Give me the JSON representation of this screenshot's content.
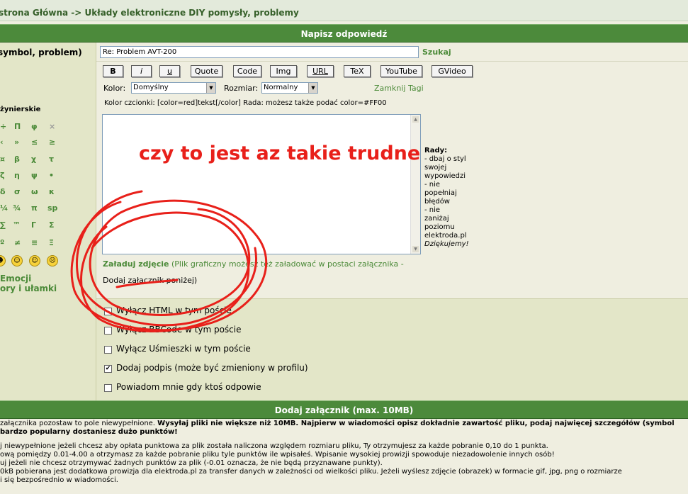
{
  "breadcrumb": "strona Główna -> Układy elektroniczne DIY pomysły, problemy",
  "reply_bar": "Napisz odpowiedź",
  "subject": {
    "label": "symbol, problem)",
    "value": "Re: Problem AVT-200",
    "search": "Szukaj"
  },
  "toolbar": [
    "B",
    "i",
    "u",
    "Quote",
    "Code",
    "Img",
    "URL",
    "TeX",
    "YouTube",
    "GVideo"
  ],
  "kolor": {
    "label": "Kolor:",
    "value": "Domyślny"
  },
  "rozmiar": {
    "label": "Rozmiar:",
    "value": "Normalny"
  },
  "close_tags": "Zamknij Tagi",
  "hint": "Kolor czcionki: [color=red]tekst[/color]  Rada: możesz także podać color=#FF00",
  "message_text": "czy to jest az takie trudne",
  "rady": {
    "title": "Rady:",
    "lines": [
      "- dbaj o styl",
      "swojej",
      "wypowiedzi",
      "- nie",
      "popełniaj",
      "błędów",
      "- nie",
      "zaniżaj",
      "poziomu",
      "elektroda.pl"
    ],
    "thanks": "Dziękujemy!"
  },
  "upload": {
    "link": "Załaduj zdjęcie",
    "text1": "(Plik graficzny możesz też załadować w postaci załącznika -",
    "text2": "Dodaj załącznik poniżej)"
  },
  "left": {
    "section": "żynierskie",
    "emoji": "Emocji",
    "fractions": "ory i ułamki",
    "symbols": [
      "÷",
      "Π",
      "φ",
      "×",
      "‹",
      "»",
      "≤",
      "≥",
      "¤",
      "β",
      "χ",
      "τ",
      "ζ",
      "η",
      "ψ",
      "•",
      "δ",
      "σ",
      "ω",
      "κ",
      "¼",
      "¾",
      "π",
      "sp",
      "∑",
      "™",
      "Γ",
      "Σ",
      "º",
      "≠",
      "≡",
      "Ξ"
    ]
  },
  "options": [
    "Wyłącz HTML w tym poście",
    "Wyłącz BBCode w tym poście",
    "Wyłącz Uśmieszki w tym poście",
    "Dodaj podpis (może być zmieniony w profilu)",
    "Powiadom mnie gdy ktoś odpowie"
  ],
  "options_checked": [
    false,
    false,
    false,
    true,
    false
  ],
  "attach_bar": "Dodaj załącznik (max. 10MB)",
  "footer": {
    "l1a": "załącznika pozostaw to pole niewypełnione. ",
    "l1b": "Wysyłaj pliki nie większe niż 10MB. Najpierw w wiadomości opisz dokładnie zawartość pliku, podaj najwięcej szczegółów (symbol",
    "l2": "bardzo popularny dostaniesz dużo punktów!",
    "l3": "j niewypełnione jeżeli chcesz aby opłata punktowa za plik została naliczona względem rozmiaru pliku, Ty otrzymujesz za każde pobranie 0,10 do 1 punkta.",
    "l4": "ową pomiędzy 0.01-4.00 a otrzymasz za każde pobranie pliku tyle punktów ile wpisałeś. Wpisanie wysokiej prowizji spowoduje niezadowolenie innych osób!",
    "l5": "uj jeżeli nie chcesz otrzymywać żadnych punktów za plik (-0.01 oznacza, że nie będą przyznawane punkty).",
    "l6": "0kB pobierana jest dodatkowa prowizja dla elektroda.pl za transfer danych w zależności od wielkości pliku. Jeżeli wyślesz zdjęcie (obrazek) w formacie gif, jpg, png o rozmiarze",
    "l7": "i się bezpośrednio w wiadomości."
  }
}
